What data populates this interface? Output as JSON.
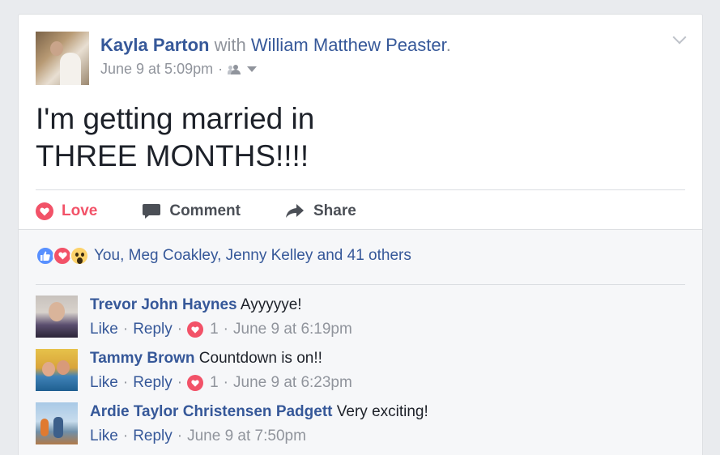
{
  "post": {
    "author": "Kayla Parton",
    "with_word": "with",
    "tagged": "William Matthew Peaster",
    "tag_period": ".",
    "timestamp": "June 9 at 5:09pm",
    "meta_separator": "·",
    "audience_icon": "friends-icon",
    "text_line1": "I'm getting married in",
    "text_line2": "THREE MONTHS!!!!"
  },
  "actions": {
    "love": "Love",
    "comment": "Comment",
    "share": "Share"
  },
  "reactions": {
    "icons": [
      "like-icon",
      "love-icon",
      "wow-icon"
    ],
    "summary": "You, Meg Coakley, Jenny Kelley and 41 others"
  },
  "comments": [
    {
      "author": "Trevor John Haynes",
      "text": "Ayyyyye!",
      "like": "Like",
      "reply": "Reply",
      "love_count": "1",
      "time": "June 9 at 6:19pm"
    },
    {
      "author": "Tammy Brown",
      "text": "Countdown is on!!",
      "like": "Like",
      "reply": "Reply",
      "love_count": "1",
      "time": "June 9 at 6:23pm"
    },
    {
      "author": "Ardie Taylor Christensen Padgett",
      "text": "Very exciting!",
      "like": "Like",
      "reply": "Reply",
      "time": "June 9 at 7:50pm"
    }
  ],
  "separator": "·",
  "colors": {
    "link": "#365899",
    "love": "#f25268",
    "muted": "#90949c",
    "background": "#e9ebee"
  }
}
